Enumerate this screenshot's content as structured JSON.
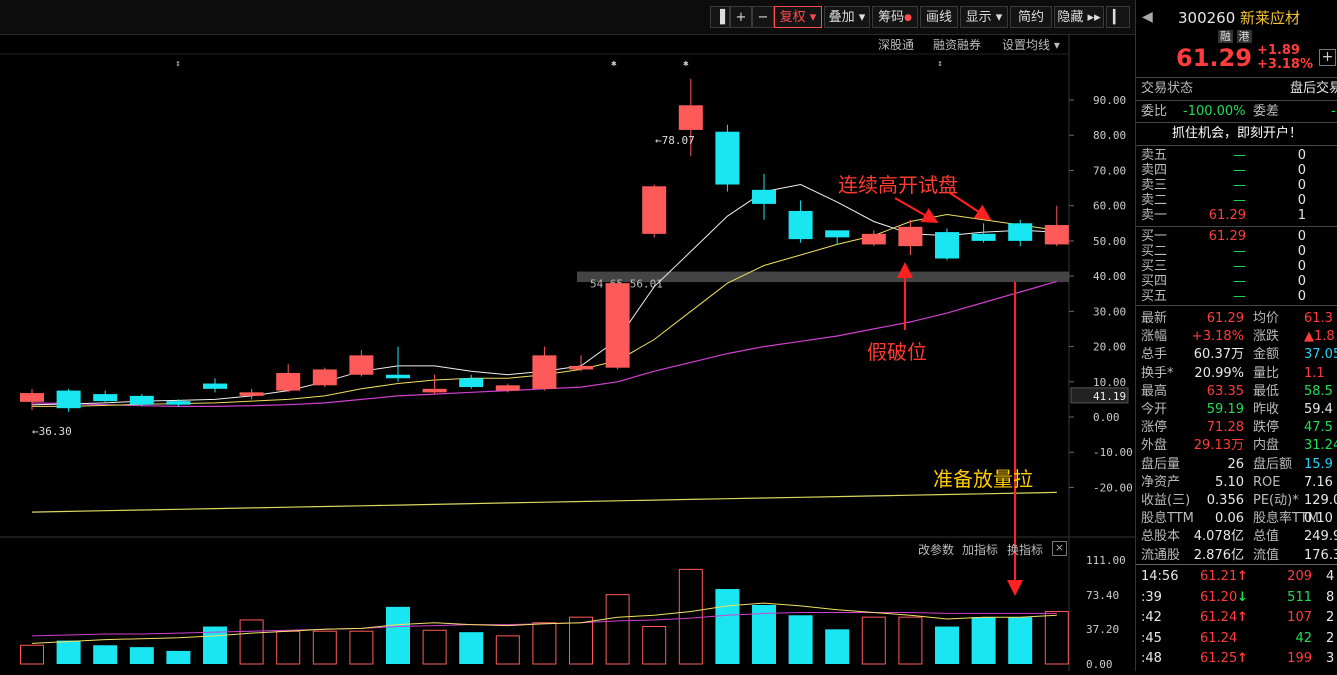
{
  "toolbar": {
    "items": [
      "复权",
      "叠加",
      "筹码",
      "画线",
      "显示",
      "简约",
      "隐藏"
    ],
    "plus": "+",
    "minus": "−",
    "more": "▸▸"
  },
  "subbar": [
    "深股通",
    "融资融券",
    "设置均线"
  ],
  "annotations": {
    "gap_test": "连续高开试盘",
    "fake_break": "假破位",
    "prep_volume": "准备放量拉"
  },
  "chart_data": {
    "type": "candlestick",
    "y_axis_labels": [
      "90.00",
      "80.00",
      "70.00",
      "60.00",
      "50.00",
      "40.00",
      "30.00",
      "20.00",
      "10.00",
      "0.00",
      "-10.00",
      "-20.00"
    ],
    "current_price_tag": "41.19",
    "high_marker": "78.07",
    "low_marker": "36.30",
    "zone_label": "54.65-56.01",
    "candles": [
      {
        "o": 4.3,
        "c": 6.8,
        "h": 8.0,
        "l": 2.0
      },
      {
        "o": 7.5,
        "c": 2.5,
        "h": 8.0,
        "l": 1.5
      },
      {
        "o": 6.5,
        "c": 4.5,
        "h": 7.5,
        "l": 4.0
      },
      {
        "o": 6.0,
        "c": 3.5,
        "h": 6.5,
        "l": 3.0
      },
      {
        "o": 4.5,
        "c": 3.5,
        "h": 5.0,
        "l": 3.0
      },
      {
        "o": 9.5,
        "c": 8.0,
        "h": 11.0,
        "l": 7.0
      },
      {
        "o": 6.0,
        "c": 7.0,
        "h": 8.0,
        "l": 5.0
      },
      {
        "o": 7.5,
        "c": 12.5,
        "h": 15.0,
        "l": 7.0
      },
      {
        "o": 9.0,
        "c": 13.5,
        "h": 14.0,
        "l": 8.5
      },
      {
        "o": 12.0,
        "c": 17.5,
        "h": 19.0,
        "l": 11.5
      },
      {
        "o": 12.0,
        "c": 11.0,
        "h": 20.0,
        "l": 10.0
      },
      {
        "o": 7.0,
        "c": 8.0,
        "h": 12.0,
        "l": 6.5
      },
      {
        "o": 11.0,
        "c": 8.5,
        "h": 12.0,
        "l": 8.0
      },
      {
        "o": 7.5,
        "c": 9.0,
        "h": 9.5,
        "l": 7.0
      },
      {
        "o": 8.0,
        "c": 17.5,
        "h": 20.0,
        "l": 7.5
      },
      {
        "o": 13.5,
        "c": 14.5,
        "h": 17.5,
        "l": 13.0
      },
      {
        "o": 14.0,
        "c": 38.0,
        "h": 38.0,
        "l": 13.5
      },
      {
        "o": 52.0,
        "c": 65.5,
        "h": 66.0,
        "l": 51.0
      },
      {
        "o": 81.5,
        "c": 88.5,
        "h": 96.0,
        "l": 74.0
      },
      {
        "o": 81.0,
        "c": 66.0,
        "h": 83.0,
        "l": 64.0
      },
      {
        "o": 64.5,
        "c": 60.5,
        "h": 69.0,
        "l": 56.0
      },
      {
        "o": 58.5,
        "c": 50.5,
        "h": 61.5,
        "l": 49.5
      },
      {
        "o": 53.0,
        "c": 51.0,
        "h": 53.0,
        "l": 49.0
      },
      {
        "o": 49.0,
        "c": 52.0,
        "h": 53.0,
        "l": 48.5
      },
      {
        "o": 48.5,
        "c": 54.0,
        "h": 56.0,
        "l": 46.0
      },
      {
        "o": 52.5,
        "c": 45.0,
        "h": 53.5,
        "l": 44.5
      },
      {
        "o": 52.0,
        "c": 50.0,
        "h": 55.0,
        "l": 49.5
      },
      {
        "o": 55.0,
        "c": 50.0,
        "h": 56.0,
        "l": 48.5
      },
      {
        "o": 49.0,
        "c": 54.5,
        "h": 60.0,
        "l": 48.5
      }
    ],
    "ma_white": [
      3.5,
      3.7,
      4.0,
      4.5,
      4.7,
      5.0,
      6.0,
      7.5,
      10.0,
      13.0,
      14.5,
      14.5,
      13.0,
      12.0,
      13.0,
      14.5,
      22.0,
      37.0,
      47.0,
      57.0,
      64.0,
      66.0,
      61.0,
      55.5,
      52.0,
      51.5,
      52.5,
      53.0,
      52.5
    ],
    "ma_yellow": [
      3.0,
      3.0,
      3.3,
      3.6,
      3.8,
      4.0,
      4.5,
      5.0,
      6.0,
      8.0,
      9.5,
      10.5,
      11.0,
      11.0,
      12.0,
      13.5,
      16.0,
      22.0,
      30.0,
      38.0,
      43.0,
      46.0,
      49.0,
      51.5,
      55.5,
      57.5,
      56.0,
      54.5,
      53.0
    ],
    "ma_magenta": [
      4.0,
      3.8,
      3.5,
      3.2,
      3.0,
      3.0,
      3.2,
      3.5,
      4.0,
      5.0,
      6.0,
      6.5,
      7.0,
      7.5,
      8.0,
      8.5,
      10.0,
      13.0,
      15.5,
      18.0,
      20.0,
      21.5,
      23.0,
      25.0,
      27.0,
      29.5,
      32.5,
      35.5,
      38.5
    ],
    "ma_long_yellow": [
      -27,
      -26.8,
      -26.6,
      -26.4,
      -26.2,
      -26.0,
      -25.8,
      -25.6,
      -25.4,
      -25.2,
      -25.0,
      -24.8,
      -24.6,
      -24.4,
      -24.2,
      -24.0,
      -23.8,
      -23.6,
      -23.4,
      -23.2,
      -23.0,
      -22.8,
      -22.6,
      -22.4,
      -22.2,
      -22.0,
      -21.8,
      -21.6,
      -21.4
    ],
    "volume": {
      "toolbar": [
        "改参数",
        "加指标",
        "换指标"
      ],
      "y_axis_labels": [
        "111.00",
        "73.40",
        "37.20",
        "0.00"
      ],
      "bars": [
        20,
        25,
        20,
        18,
        14,
        40,
        47,
        35,
        35,
        35,
        61,
        36,
        34,
        30,
        44,
        50,
        74,
        40,
        101,
        80,
        63,
        52,
        37,
        50,
        50,
        40,
        50,
        50,
        56
      ],
      "ma_yellow": [
        22,
        24,
        26,
        27,
        28,
        30,
        33,
        35,
        37,
        38,
        42,
        44,
        42,
        41,
        43,
        44,
        50,
        52,
        56,
        62,
        65,
        62,
        58,
        55,
        52,
        48,
        50,
        50,
        52
      ],
      "ma_magenta": [
        30,
        31,
        32,
        32,
        33,
        34,
        35,
        36,
        37,
        38,
        40,
        41,
        42,
        42,
        43,
        44,
        46,
        47,
        49,
        52,
        54,
        55,
        55,
        55,
        55,
        54,
        54,
        54,
        54
      ]
    }
  },
  "quote": {
    "code": "300260",
    "name": "新莱应材",
    "tags": [
      "融",
      "港"
    ],
    "price": "61.29",
    "change": "+1.89",
    "change_pct": "+3.18%",
    "status_label": "交易状态",
    "status_value": "盘后交易",
    "weibi_label": "委比",
    "weibi_value": "-100.00%",
    "weicha_label": "委差",
    "weicha_value": "-1",
    "ad": "抓住机会，即刻开户！",
    "sells": [
      {
        "label": "卖五",
        "price": "—",
        "vol": "0"
      },
      {
        "label": "卖四",
        "price": "—",
        "vol": "0"
      },
      {
        "label": "卖三",
        "price": "—",
        "vol": "0"
      },
      {
        "label": "卖二",
        "price": "—",
        "vol": "0"
      },
      {
        "label": "卖一",
        "price": "61.29",
        "vol": "1"
      }
    ],
    "buys": [
      {
        "label": "买一",
        "price": "61.29",
        "vol": "0"
      },
      {
        "label": "买二",
        "price": "—",
        "vol": "0"
      },
      {
        "label": "买三",
        "price": "—",
        "vol": "0"
      },
      {
        "label": "买四",
        "price": "—",
        "vol": "0"
      },
      {
        "label": "买五",
        "price": "—",
        "vol": "0"
      }
    ],
    "stats": [
      {
        "l1": "最新",
        "v1": "61.29",
        "c1": "red",
        "l2": "均价",
        "v2": "61.3",
        "c2": "red"
      },
      {
        "l1": "涨幅",
        "v1": "+3.18%",
        "c1": "red",
        "l2": "涨跌",
        "v2": "▲1.8",
        "c2": "red"
      },
      {
        "l1": "总手",
        "v1": "60.37万",
        "c1": "wht",
        "l2": "金额",
        "v2": "37.05亿",
        "c2": "cyan"
      },
      {
        "l1": "换手*",
        "v1": "20.99%",
        "c1": "wht",
        "l2": "量比",
        "v2": "1.1",
        "c2": "red"
      },
      {
        "l1": "最高",
        "v1": "63.35",
        "c1": "red",
        "l2": "最低",
        "v2": "58.5",
        "c2": "grn"
      },
      {
        "l1": "今开",
        "v1": "59.19",
        "c1": "grn",
        "l2": "昨收",
        "v2": "59.4",
        "c2": "wht"
      },
      {
        "l1": "涨停",
        "v1": "71.28",
        "c1": "red",
        "l2": "跌停",
        "v2": "47.5",
        "c2": "grn"
      },
      {
        "l1": "外盘",
        "v1": "29.13万",
        "c1": "red",
        "l2": "内盘",
        "v2": "31.24万",
        "c2": "grn"
      },
      {
        "l1": "盘后量",
        "v1": "26",
        "c1": "wht",
        "l2": "盘后额",
        "v2": "15.9",
        "c2": "cyan"
      },
      {
        "l1": "净资产",
        "v1": "5.10",
        "c1": "wht",
        "l2": "ROE",
        "v2": "7.16",
        "c2": "wht"
      },
      {
        "l1": "收益(三)",
        "v1": "0.356",
        "c1": "wht",
        "l2": "PE(动)*",
        "v2": "129.0",
        "c2": "wht"
      },
      {
        "l1": "股息TTM",
        "v1": "0.06",
        "c1": "wht",
        "l2": "股息率TTM",
        "v2": "0.10",
        "c2": "wht"
      },
      {
        "l1": "总股本",
        "v1": "4.078亿",
        "c1": "wht",
        "l2": "总值",
        "v2": "249.9",
        "c2": "wht"
      },
      {
        "l1": "流通股",
        "v1": "2.876亿",
        "c1": "wht",
        "l2": "流值",
        "v2": "176.3",
        "c2": "wht"
      }
    ],
    "ticks": [
      {
        "t": "14:56",
        "p": "61.21",
        "arrow": "↑",
        "ac": "red",
        "v": "209",
        "vc": "red",
        "n": "4"
      },
      {
        "t": ":39",
        "p": "61.20",
        "arrow": "↓",
        "ac": "grn",
        "v": "511",
        "vc": "grn",
        "n": "8"
      },
      {
        "t": ":42",
        "p": "61.24",
        "arrow": "↑",
        "ac": "red",
        "v": "107",
        "vc": "red",
        "n": "2"
      },
      {
        "t": ":45",
        "p": "61.24",
        "arrow": "",
        "ac": "red",
        "v": "42",
        "vc": "grn",
        "n": "2"
      },
      {
        "t": ":48",
        "p": "61.25",
        "arrow": "↑",
        "ac": "red",
        "v": "199",
        "vc": "red",
        "n": "3"
      }
    ]
  }
}
